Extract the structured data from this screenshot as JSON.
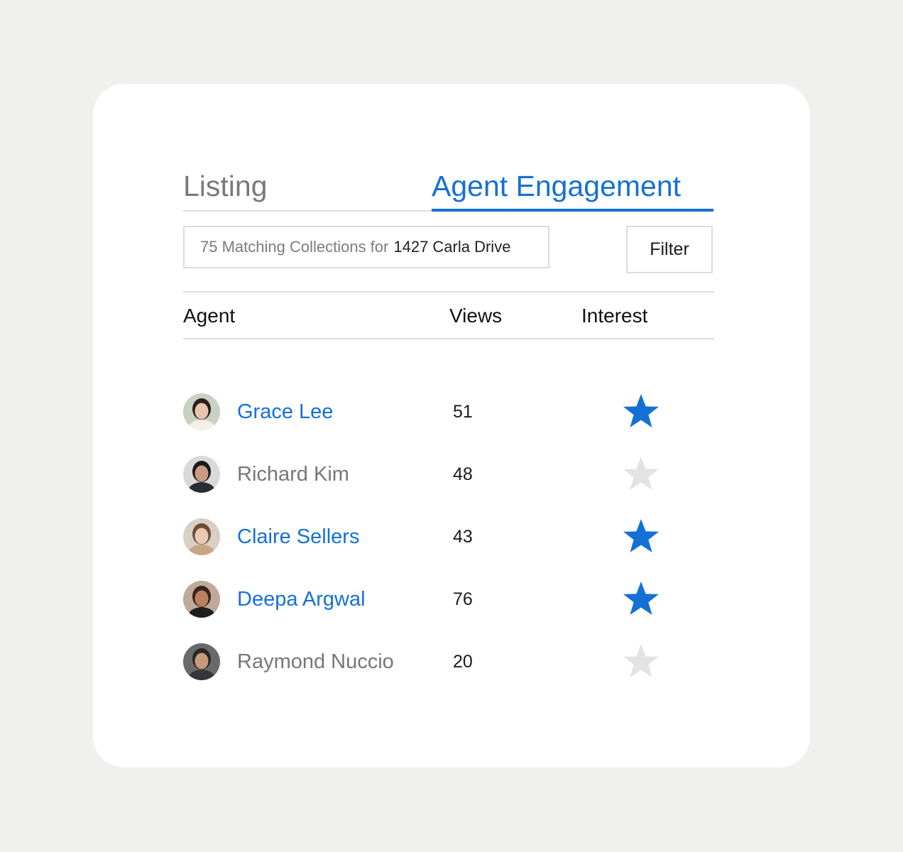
{
  "tabs": {
    "listing": "Listing",
    "engagement": "Agent Engagement"
  },
  "search": {
    "prefix": "75 Matching Collections for",
    "address": "1427 Carla Drive"
  },
  "filter_label": "Filter",
  "table": {
    "headers": {
      "agent": "Agent",
      "views": "Views",
      "interest": "Interest"
    },
    "rows": [
      {
        "name": "Grace Lee",
        "views": "51",
        "interested": true,
        "avatar_icon": "avatar-icon"
      },
      {
        "name": "Richard Kim",
        "views": "48",
        "interested": false,
        "avatar_icon": "avatar-icon"
      },
      {
        "name": "Claire Sellers",
        "views": "43",
        "interested": true,
        "avatar_icon": "avatar-icon"
      },
      {
        "name": "Deepa Argwal",
        "views": "76",
        "interested": true,
        "avatar_icon": "avatar-icon"
      },
      {
        "name": "Raymond Nuccio",
        "views": "20",
        "interested": false,
        "avatar_icon": "avatar-icon"
      }
    ]
  },
  "colors": {
    "accent": "#1570d6",
    "star_off": "#e3e3e3",
    "muted_text": "#777777",
    "background": "#f0f0ef"
  }
}
